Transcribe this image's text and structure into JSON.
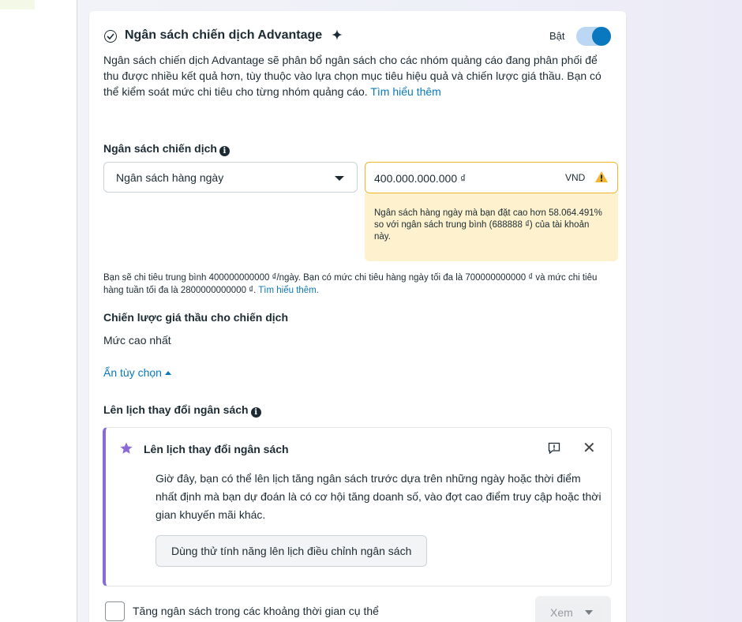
{
  "header": {
    "title": "Ngân sách chiến dịch Advantage",
    "toggle_label": "Bật",
    "toggle_on": true,
    "accent": "#0a78be"
  },
  "description": {
    "text": "Ngân sách chiến dịch Advantage sẽ phân bổ ngân sách cho các nhóm quảng cáo đang phân phối để thu được nhiều kết quả hơn, tùy thuộc vào lựa chọn mục tiêu hiệu quả và chiến lược giá thầu. Bạn có thể kiểm soát mức chi tiêu cho từng nhóm quảng cáo.",
    "link": "Tìm hiểu thêm"
  },
  "budget": {
    "label": "Ngân sách chiến dịch",
    "type_selected": "Ngân sách hàng ngày",
    "amount_value": "400.000.000.000 ₫",
    "currency": "VND",
    "warning": "Ngân sách hàng ngày mà bạn đặt cao hơn 58.064.491% so với ngân sách trung bình (688888 ₫) của tài khoản này.",
    "spend_note": "Bạn sẽ chi tiêu trung bình 400000000000 ₫/ngày. Bạn có mức chi tiêu hàng ngày tối đa là 700000000000 ₫ và mức chi tiêu hàng tuần tối đa là 2800000000000 ₫.",
    "spend_link": "Tìm hiểu thêm."
  },
  "bid_strategy": {
    "label": "Chiến lược giá thầu cho chiến dịch",
    "value": "Mức cao nhất"
  },
  "hide_options": "Ẩn tùy chọn",
  "schedule": {
    "label": "Lên lịch thay đổi ngân sách",
    "promo_title": "Lên lịch thay đổi ngân sách",
    "promo_body": "Giờ đây, bạn có thể lên lịch tăng ngân sách trước dựa trên những ngày hoặc thời điểm nhất định mà bạn dự đoán là có cơ hội tăng doanh số, vào đợt cao điểm truy cập hoặc thời gian khuyến mãi khác.",
    "promo_button": "Dùng thử tính năng lên lịch điều chỉnh ngân sách",
    "promo_accent": "#8a6bd6",
    "increase_label": "Tăng ngân sách trong các khoảng thời gian cụ thể",
    "view_button": "Xem"
  },
  "icons": {
    "check": "check-circle-icon",
    "sparkle": "sparkle-icon",
    "info": "info-icon",
    "warning": "warning-icon",
    "star": "star-icon",
    "feedback": "feedback-icon",
    "close": "close-icon"
  },
  "warning_color": "#f5b52a"
}
